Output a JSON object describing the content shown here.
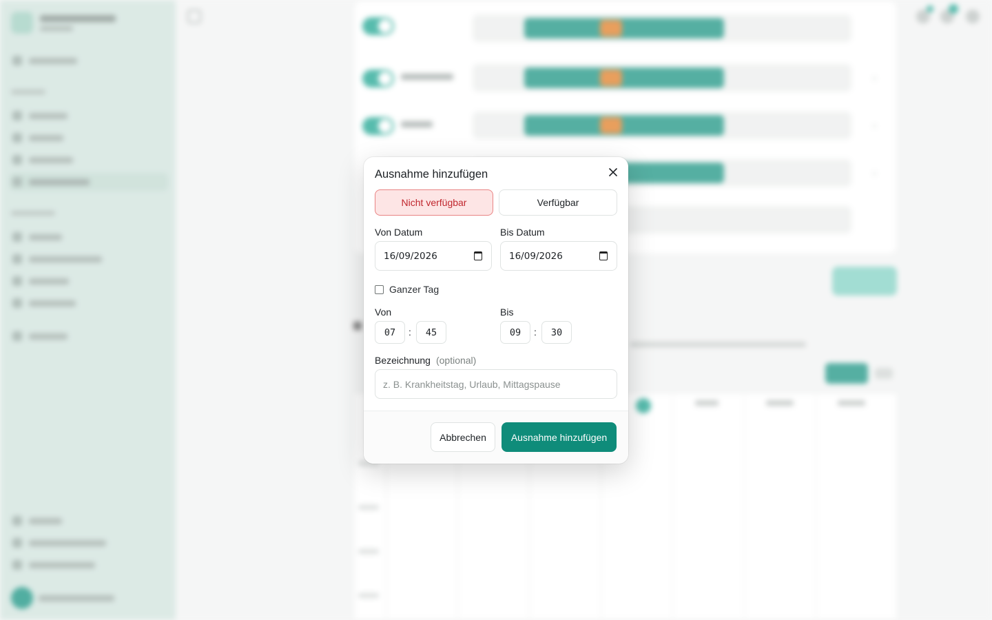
{
  "modal": {
    "title": "Ausnahme hinzufügen",
    "toggle_unavailable": "Nicht verfügbar",
    "toggle_available": "Verfügbar",
    "from_date_label": "Von Datum",
    "from_date_value": "16/09/2026",
    "to_date_label": "Bis Datum",
    "to_date_value": "16/09/2026",
    "all_day_label": "Ganzer Tag",
    "all_day_checked": false,
    "from_label": "Von",
    "from_hour": "07",
    "from_minute": "45",
    "to_label": "Bis",
    "to_hour": "09",
    "to_minute": "30",
    "time_separator": ":",
    "description_label": "Bezeichnung",
    "description_optional": "(optional)",
    "description_placeholder": "z. B. Krankheitstag, Urlaub, Mittagspause",
    "description_value": "",
    "cancel_label": "Abbrechen",
    "submit_label": "Ausnahme hinzufügen"
  },
  "colors": {
    "primary": "#0f8c7a",
    "unavailable_bg": "#fde5e5",
    "unavailable_border": "#e98383",
    "unavailable_text": "#c0262d",
    "break_slot": "#e07a1f"
  }
}
